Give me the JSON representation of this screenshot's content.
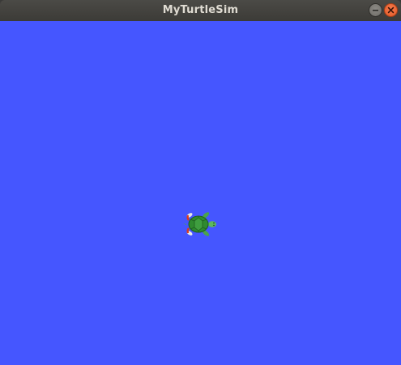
{
  "window": {
    "title": "MyTurtleSim"
  },
  "controls": {
    "minimize_icon": "minimize-icon",
    "close_icon": "close-icon",
    "close_color": "#e95420",
    "minimize_color": "#7a7873"
  },
  "canvas": {
    "background_color": "#4556ff"
  },
  "turtle": {
    "icon": "turtle-icon",
    "shell_color": "#2f8a2f",
    "body_color": "#5cb85c",
    "heading": "east"
  }
}
